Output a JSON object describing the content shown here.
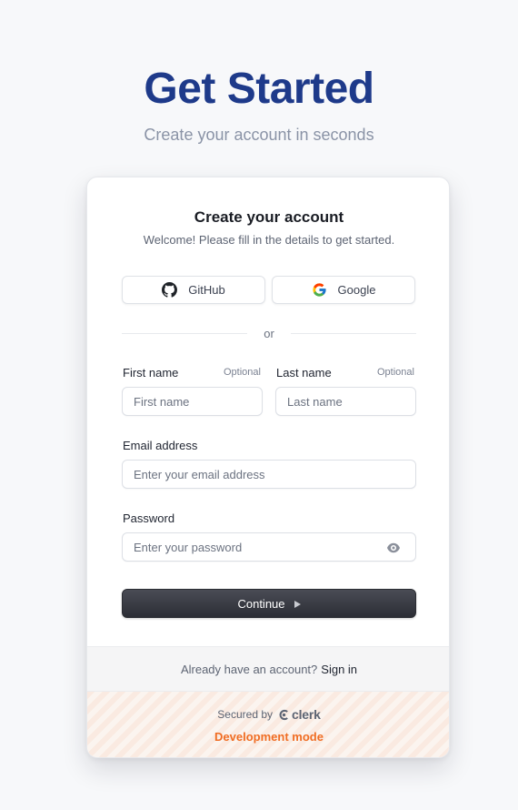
{
  "hero": {
    "title": "Get Started",
    "subtitle": "Create your account in seconds"
  },
  "card": {
    "title": "Create your account",
    "subtitle": "Welcome! Please fill in the details to get started.",
    "social": {
      "github": {
        "label": "GitHub",
        "icon": "github-icon"
      },
      "google": {
        "label": "Google",
        "icon": "google-icon"
      }
    },
    "divider_text": "or",
    "fields": {
      "first_name": {
        "label": "First name",
        "optional": "Optional",
        "placeholder": "First name"
      },
      "last_name": {
        "label": "Last name",
        "optional": "Optional",
        "placeholder": "Last name"
      },
      "email": {
        "label": "Email address",
        "placeholder": "Enter your email address"
      },
      "password": {
        "label": "Password",
        "placeholder": "Enter your password",
        "toggle_icon": "eye-icon"
      }
    },
    "continue_label": "Continue",
    "continue_icon": "caret-right-icon"
  },
  "footer": {
    "signin_prompt": "Already have an account?",
    "signin_link": "Sign in",
    "secured_by": "Secured by",
    "brand": "clerk",
    "dev_mode": "Development mode"
  },
  "colors": {
    "title": "#1e3a8a",
    "dev_mode": "#f06d23",
    "button": "#2c2e35"
  }
}
